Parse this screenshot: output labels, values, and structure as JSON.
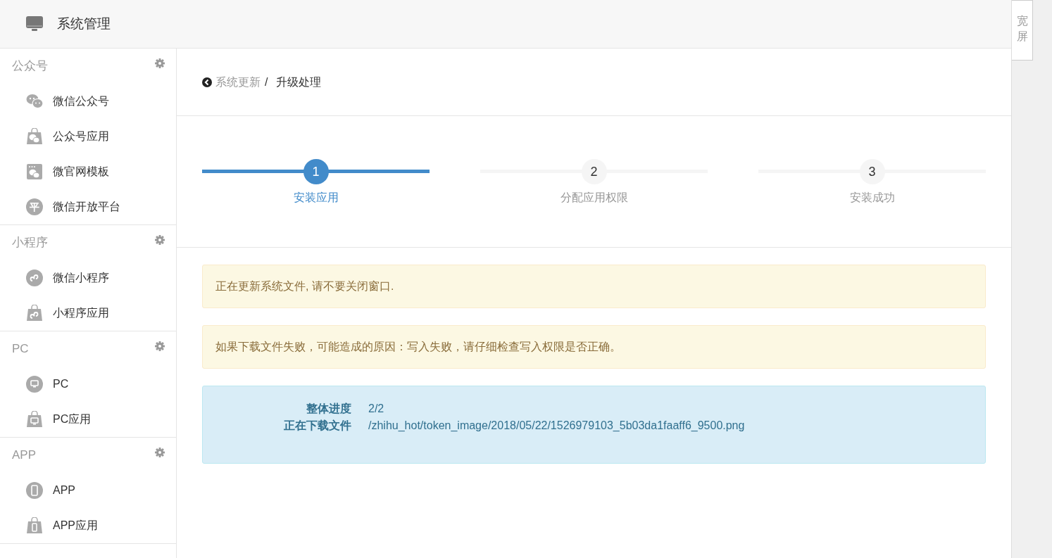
{
  "header": {
    "title": "系统管理"
  },
  "sidebar": {
    "sections": [
      {
        "title": "公众号",
        "items": [
          {
            "label": "微信公众号",
            "kind": "wechat"
          },
          {
            "label": "公众号应用",
            "kind": "bag-wechat"
          },
          {
            "label": "微官网模板",
            "kind": "window-wechat"
          },
          {
            "label": "微信开放平台",
            "kind": "glyph",
            "glyph": "平"
          }
        ]
      },
      {
        "title": "小程序",
        "items": [
          {
            "label": "微信小程序",
            "kind": "mini"
          },
          {
            "label": "小程序应用",
            "kind": "bag-mini"
          }
        ]
      },
      {
        "title": "PC",
        "items": [
          {
            "label": "PC",
            "kind": "pc"
          },
          {
            "label": "PC应用",
            "kind": "bag-pc"
          }
        ]
      },
      {
        "title": "APP",
        "items": [
          {
            "label": "APP",
            "kind": "app"
          },
          {
            "label": "APP应用",
            "kind": "bag-app"
          }
        ]
      }
    ]
  },
  "breadcrumb": {
    "parent": "系统更新",
    "separator": "/",
    "current": "升级处理"
  },
  "steps": [
    {
      "number": "1",
      "label": "安装应用",
      "selected": true
    },
    {
      "number": "2",
      "label": "分配应用权限",
      "selected": false
    },
    {
      "number": "3",
      "label": "安装成功",
      "selected": false
    }
  ],
  "alerts": [
    {
      "kind": "warning",
      "text": "正在更新系统文件, 请不要关闭窗口."
    },
    {
      "kind": "warning",
      "text": "如果下载文件失败，可能造成的原因：写入失败，请仔细检查写入权限是否正确。"
    }
  ],
  "progress": {
    "rows": [
      {
        "label": "整体进度",
        "value": "2/2"
      },
      {
        "label": "正在下载文件",
        "value": "/zhihu_hot/token_image/2018/05/22/1526979103_5b03da1faaff6_9500.png"
      }
    ]
  },
  "wide_button": {
    "label": "宽屏"
  }
}
